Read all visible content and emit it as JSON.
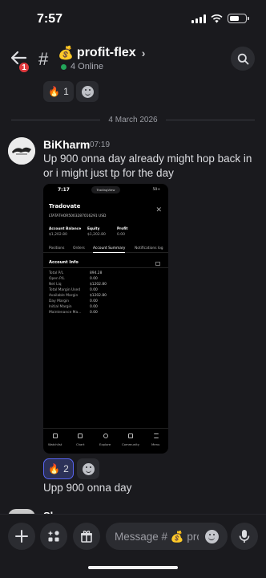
{
  "status_bar": {
    "time": "7:57"
  },
  "header": {
    "notification_count": "1",
    "channel_emoji": "💰",
    "channel_name": "profit-flex",
    "chevron": "›",
    "online_text": "4 Online"
  },
  "top_reactions": [
    {
      "emoji": "🔥",
      "count": "1"
    }
  ],
  "date_divider": "4 March 2026",
  "message": {
    "author": "BiKharm",
    "time": "07:19",
    "text": "Up 900 onna day already might hop back in or i might just tp  for the day",
    "reactions": [
      {
        "emoji": "🔥",
        "count": "2"
      }
    ],
    "followup": "Upp 900 onna day"
  },
  "attachment": {
    "time": "7:17",
    "pill": "TradingView",
    "battery": "50+",
    "broker": "Tradovate",
    "account": "LTATATHOR5003287016291 USD",
    "headers": [
      "Account Balance",
      "Equity",
      "Profit"
    ],
    "values": [
      "$1,202.80",
      "$1,202.80",
      "0.00"
    ],
    "tabs": [
      "Positions",
      "Orders",
      "Account Summary",
      "Notifications log"
    ],
    "section_title": "Account Info",
    "rows": [
      {
        "k": "Total P/L",
        "v": "894.28"
      },
      {
        "k": "Open P/L",
        "v": "0.00"
      },
      {
        "k": "Net Liq",
        "v": "$1202.80"
      },
      {
        "k": "Total Margin Used",
        "v": "0.00"
      },
      {
        "k": "Available Margin",
        "v": "$1202.80"
      },
      {
        "k": "Day Margin",
        "v": "0.00"
      },
      {
        "k": "Initial Margin",
        "v": "0.00"
      },
      {
        "k": "Maintenance Ma...",
        "v": "0.00"
      }
    ],
    "nav": [
      "Watchlist",
      "Chart",
      "Explore",
      "Community",
      "Menu"
    ]
  },
  "next_message": {
    "author": "Sleep"
  },
  "composer": {
    "placeholder": "Message # 💰 pro..."
  },
  "colors": {
    "accent": "#5865f2",
    "online": "#23a55a",
    "badge": "#e0393e",
    "background": "#1a1a1e"
  },
  "icons": [
    "back-arrow-icon",
    "hash-icon",
    "search-icon",
    "add-reaction-icon",
    "plus-icon",
    "apps-icon",
    "gift-icon",
    "emoji-icon",
    "microphone-icon"
  ]
}
